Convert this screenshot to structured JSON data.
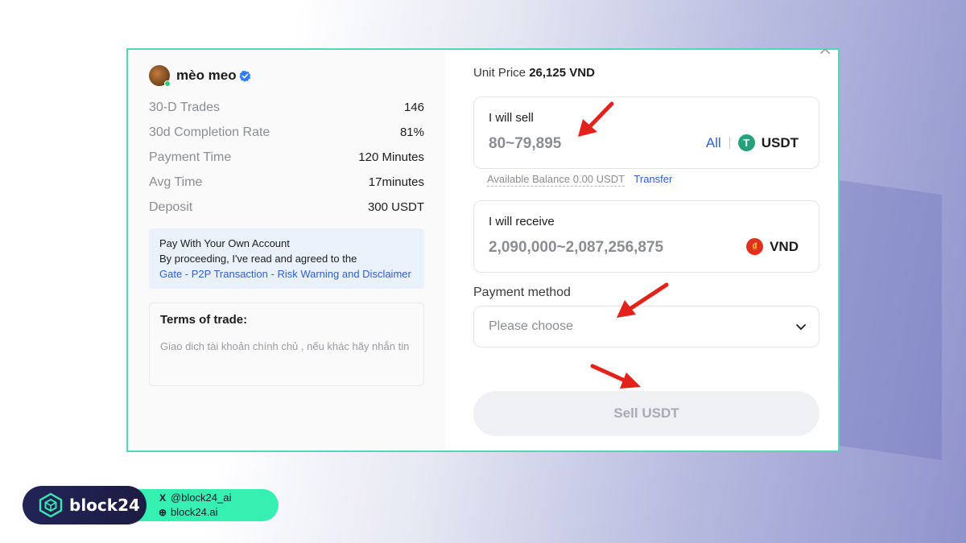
{
  "seller": {
    "name": "mèo meo",
    "stats": [
      {
        "label": "30-D Trades",
        "value": "146"
      },
      {
        "label": "30d Completion Rate",
        "value": "81%"
      },
      {
        "label": "Payment Time",
        "value": "120 Minutes"
      },
      {
        "label": "Avg Time",
        "value": "17minutes"
      },
      {
        "label": "Deposit",
        "value": "300 USDT"
      }
    ],
    "notice": {
      "line1": "Pay With Your Own Account",
      "line2": "By proceeding, I've read and agreed to the",
      "link": "Gate - P2P Transaction - Risk Warning and Disclaimer"
    },
    "terms": {
      "title": "Terms of trade:",
      "text": "Giao dich tài khoản chính chủ , nếu khác hãy nhắn tin"
    }
  },
  "order": {
    "unit_price_label": "Unit Price",
    "unit_price_value": "26,125 VND",
    "sell": {
      "label": "I will sell",
      "range": "80~79,895",
      "all_label": "All",
      "currency": "USDT",
      "coin_glyph": "T"
    },
    "balance": {
      "text": "Available Balance 0.00 USDT",
      "transfer_label": "Transfer"
    },
    "receive": {
      "label": "I will receive",
      "range": "2,090,000~2,087,256,875",
      "currency": "VND",
      "coin_glyph": "₫"
    },
    "payment_method": {
      "label": "Payment method",
      "placeholder": "Please choose"
    },
    "submit_label": "Sell USDT"
  },
  "branding": {
    "name": "block24",
    "twitter": "@block24_ai",
    "website": "block24.ai",
    "twitter_glyph": "X",
    "web_glyph": "⊕"
  },
  "colors": {
    "accent_border": "#4fd9b7",
    "link": "#2b5fd9",
    "annotation_arrow": "#e3231b"
  }
}
